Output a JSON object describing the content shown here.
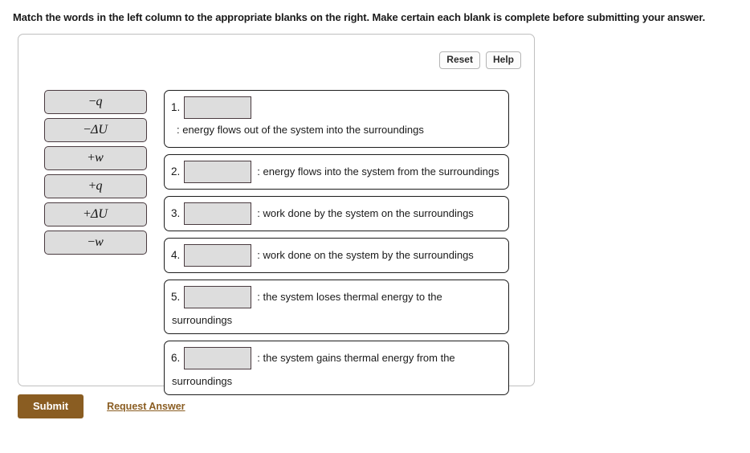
{
  "instruction": "Match the words in the left column to the appropriate blanks on the right. Make certain each blank is complete before submitting your answer.",
  "toolbar": {
    "reset_label": "Reset",
    "help_label": "Help"
  },
  "word_bank": {
    "tiles": [
      {
        "sign": "−",
        "symbol": "q"
      },
      {
        "sign": "−",
        "symbol": "ΔU"
      },
      {
        "sign": "+",
        "symbol": "w"
      },
      {
        "sign": "+",
        "symbol": "q"
      },
      {
        "sign": "+",
        "symbol": "ΔU"
      },
      {
        "sign": "−",
        "symbol": "w"
      }
    ]
  },
  "match_items": [
    {
      "number": "1.",
      "slot_value": "",
      "text": ": energy flows out of the system into the surroundings",
      "text_wrap": ""
    },
    {
      "number": "2.",
      "slot_value": "",
      "text": ": energy flows into the system from the surroundings",
      "text_wrap": ""
    },
    {
      "number": "3.",
      "slot_value": "",
      "text": ": work done by the system on the surroundings",
      "text_wrap": ""
    },
    {
      "number": "4.",
      "slot_value": "",
      "text": ": work done on the system by the surroundings",
      "text_wrap": ""
    },
    {
      "number": "5.",
      "slot_value": "",
      "text": ": the system loses thermal energy to the",
      "text_wrap": "surroundings"
    },
    {
      "number": "6.",
      "slot_value": "",
      "text": ": the system gains thermal energy from the",
      "text_wrap": "surroundings"
    }
  ],
  "actions": {
    "submit_label": "Submit",
    "request_answer_label": "Request Answer"
  },
  "colors": {
    "accent_brown": "#8a5d22",
    "tile_fill": "#dddddd",
    "tile_border": "#4a3b40",
    "item_border": "#1d1d1d",
    "panel_border": "#bfbfbf"
  }
}
